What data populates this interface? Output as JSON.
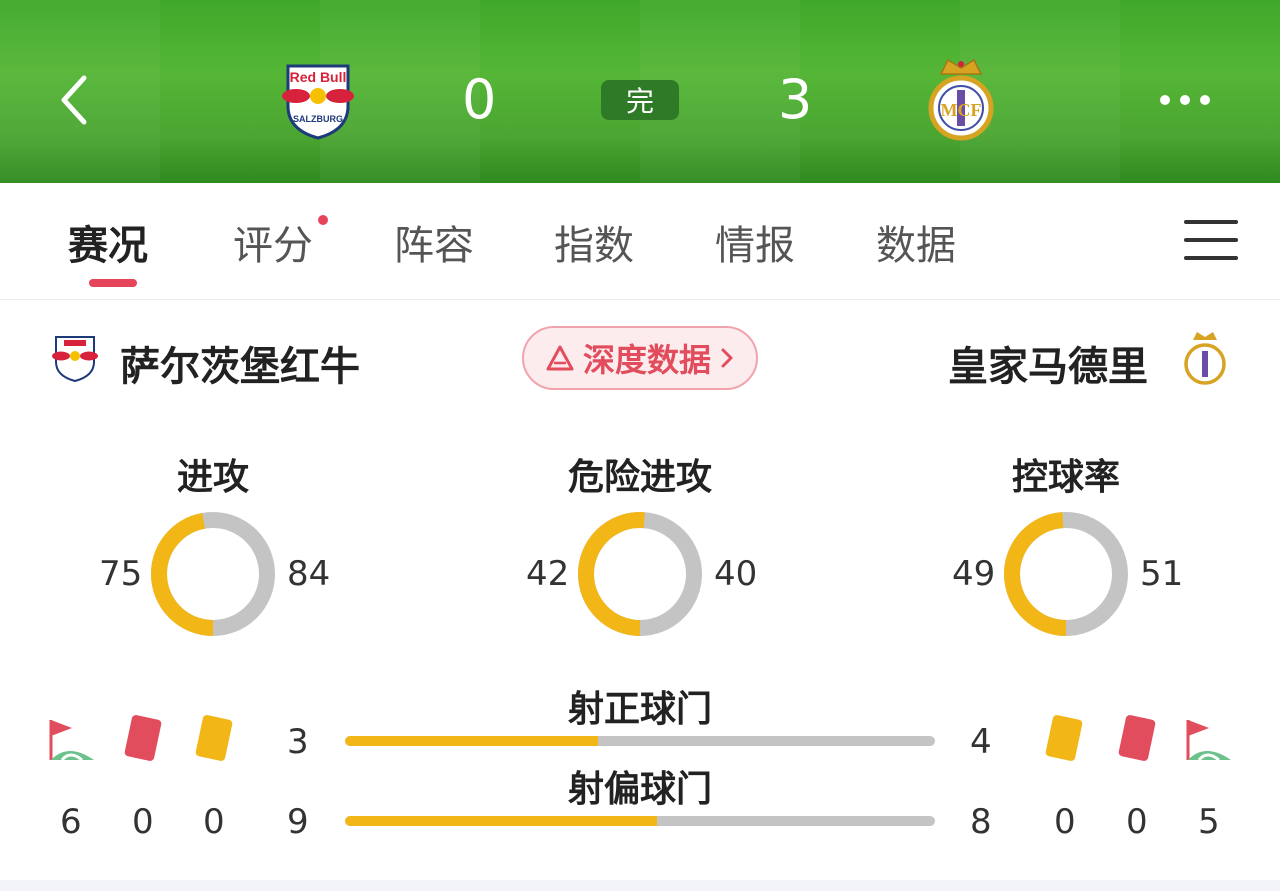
{
  "header": {
    "home_score": "0",
    "status": "完",
    "away_score": "3",
    "home_logo_text": "Red Bull",
    "home_logo_subtext": "SALZBURG"
  },
  "tabs": [
    {
      "label": "赛况",
      "active": true
    },
    {
      "label": "评分",
      "badge_dot": true
    },
    {
      "label": "阵容"
    },
    {
      "label": "指数"
    },
    {
      "label": "情报"
    },
    {
      "label": "数据"
    }
  ],
  "teams": {
    "home_name": "萨尔茨堡红牛",
    "away_name": "皇家马德里",
    "deep_data_label": "深度数据"
  },
  "stats": [
    {
      "title": "进攻",
      "home": 75,
      "away": 84
    },
    {
      "title": "危险进攻",
      "home": 42,
      "away": 40
    },
    {
      "title": "控球率",
      "home": 49,
      "away": 51
    }
  ],
  "shots": [
    {
      "title": "射正球门",
      "home": 3,
      "away": 4
    },
    {
      "title": "射偏球门",
      "home": 9,
      "away": 8
    }
  ],
  "cards": {
    "home": {
      "corners": "6",
      "red": "0",
      "yellow": "0"
    },
    "away": {
      "yellow": "0",
      "red": "0",
      "corners": "5"
    }
  },
  "colors": {
    "accent": "#e5445a",
    "home_bar": "#f2b617",
    "away_bar": "#c4c4c4",
    "header_green": "#4aa531"
  }
}
